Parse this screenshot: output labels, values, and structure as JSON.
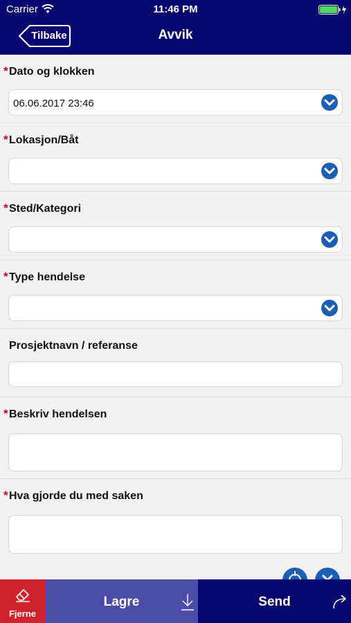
{
  "status_bar": {
    "carrier": "Carrier",
    "time": "11:46 PM"
  },
  "nav": {
    "back_label": "Tilbake",
    "title": "Avvik"
  },
  "form": {
    "fields": [
      {
        "label": "Dato og klokken",
        "required": true,
        "value": "06.06.2017 23:46",
        "type": "dropdown"
      },
      {
        "label": "Lokasjon/Båt",
        "required": true,
        "value": "",
        "type": "dropdown"
      },
      {
        "label": "Sted/Kategori",
        "required": true,
        "value": "",
        "type": "dropdown"
      },
      {
        "label": "Type hendelse",
        "required": true,
        "value": "",
        "type": "dropdown"
      },
      {
        "label": "Prosjektnavn / referanse",
        "required": false,
        "value": "",
        "type": "text"
      },
      {
        "label": "Beskriv hendelsen",
        "required": true,
        "value": "",
        "type": "textarea"
      },
      {
        "label": "Hva gjorde du med saken",
        "required": true,
        "value": "",
        "type": "textarea"
      }
    ]
  },
  "toolbar": {
    "remove_label": "Fjerne",
    "save_label": "Lagre",
    "send_label": "Send"
  },
  "colors": {
    "nav_bg": "#08066e",
    "required": "#d0021b",
    "dropdown_icon": "#1a5fb4",
    "remove_bg": "#d0222c",
    "save_bg": "#4c4ca8"
  },
  "icons": [
    "wifi-icon",
    "battery-icon",
    "back-arrow-icon",
    "chevron-down-icon",
    "locate-icon",
    "close-icon",
    "eraser-icon",
    "download-icon",
    "share-icon"
  ]
}
